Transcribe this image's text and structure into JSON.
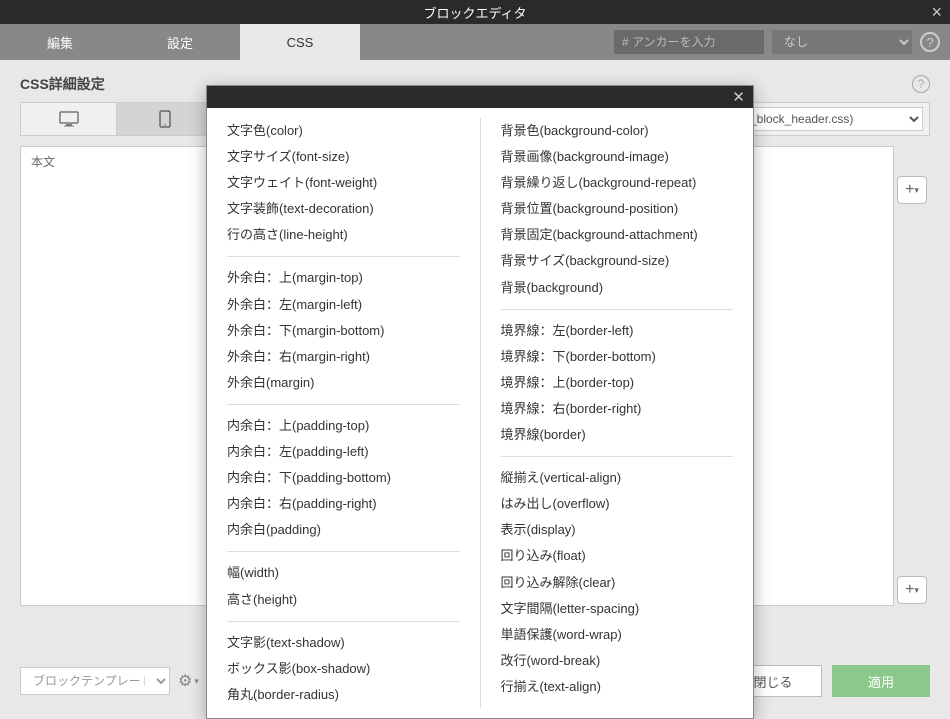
{
  "title": "ブロックエディタ",
  "tabs": {
    "edit": "編集",
    "settings": "設定",
    "css": "CSS"
  },
  "anchor_placeholder": "# アンカーを入力",
  "anchor_select": "なし",
  "subtitle": "CSS詳細設定",
  "file_select": "ト(_block_header.css)",
  "left_panel_header": "本文",
  "template_placeholder": "ブロックテンプレート",
  "buttons": {
    "close": "閉じる",
    "apply": "適用"
  },
  "css_props": {
    "left": [
      {
        "items": [
          "文字色(color)",
          "文字サイズ(font-size)",
          "文字ウェイト(font-weight)",
          "文字装飾(text-decoration)",
          "行の高さ(line-height)"
        ]
      },
      {
        "items": [
          "外余白：上(margin-top)",
          "外余白：左(margin-left)",
          "外余白：下(margin-bottom)",
          "外余白：右(margin-right)",
          "外余白(margin)"
        ]
      },
      {
        "items": [
          "内余白：上(padding-top)",
          "内余白：左(padding-left)",
          "内余白：下(padding-bottom)",
          "内余白：右(padding-right)",
          "内余白(padding)"
        ]
      },
      {
        "items": [
          "幅(width)",
          "高さ(height)"
        ]
      },
      {
        "items": [
          "文字影(text-shadow)",
          "ボックス影(box-shadow)",
          "角丸(border-radius)"
        ]
      }
    ],
    "right": [
      {
        "items": [
          "背景色(background-color)",
          "背景画像(background-image)",
          "背景繰り返し(background-repeat)",
          "背景位置(background-position)",
          "背景固定(background-attachment)",
          "背景サイズ(background-size)",
          "背景(background)"
        ]
      },
      {
        "items": [
          "境界線：左(border-left)",
          "境界線：下(border-bottom)",
          "境界線：上(border-top)",
          "境界線：右(border-right)",
          "境界線(border)"
        ]
      },
      {
        "items": [
          "縦揃え(vertical-align)",
          "はみ出し(overflow)",
          "表示(display)",
          "回り込み(float)",
          "回り込み解除(clear)",
          "文字間隔(letter-spacing)",
          "単語保護(word-wrap)",
          "改行(word-break)",
          "行揃え(text-align)"
        ]
      }
    ]
  }
}
